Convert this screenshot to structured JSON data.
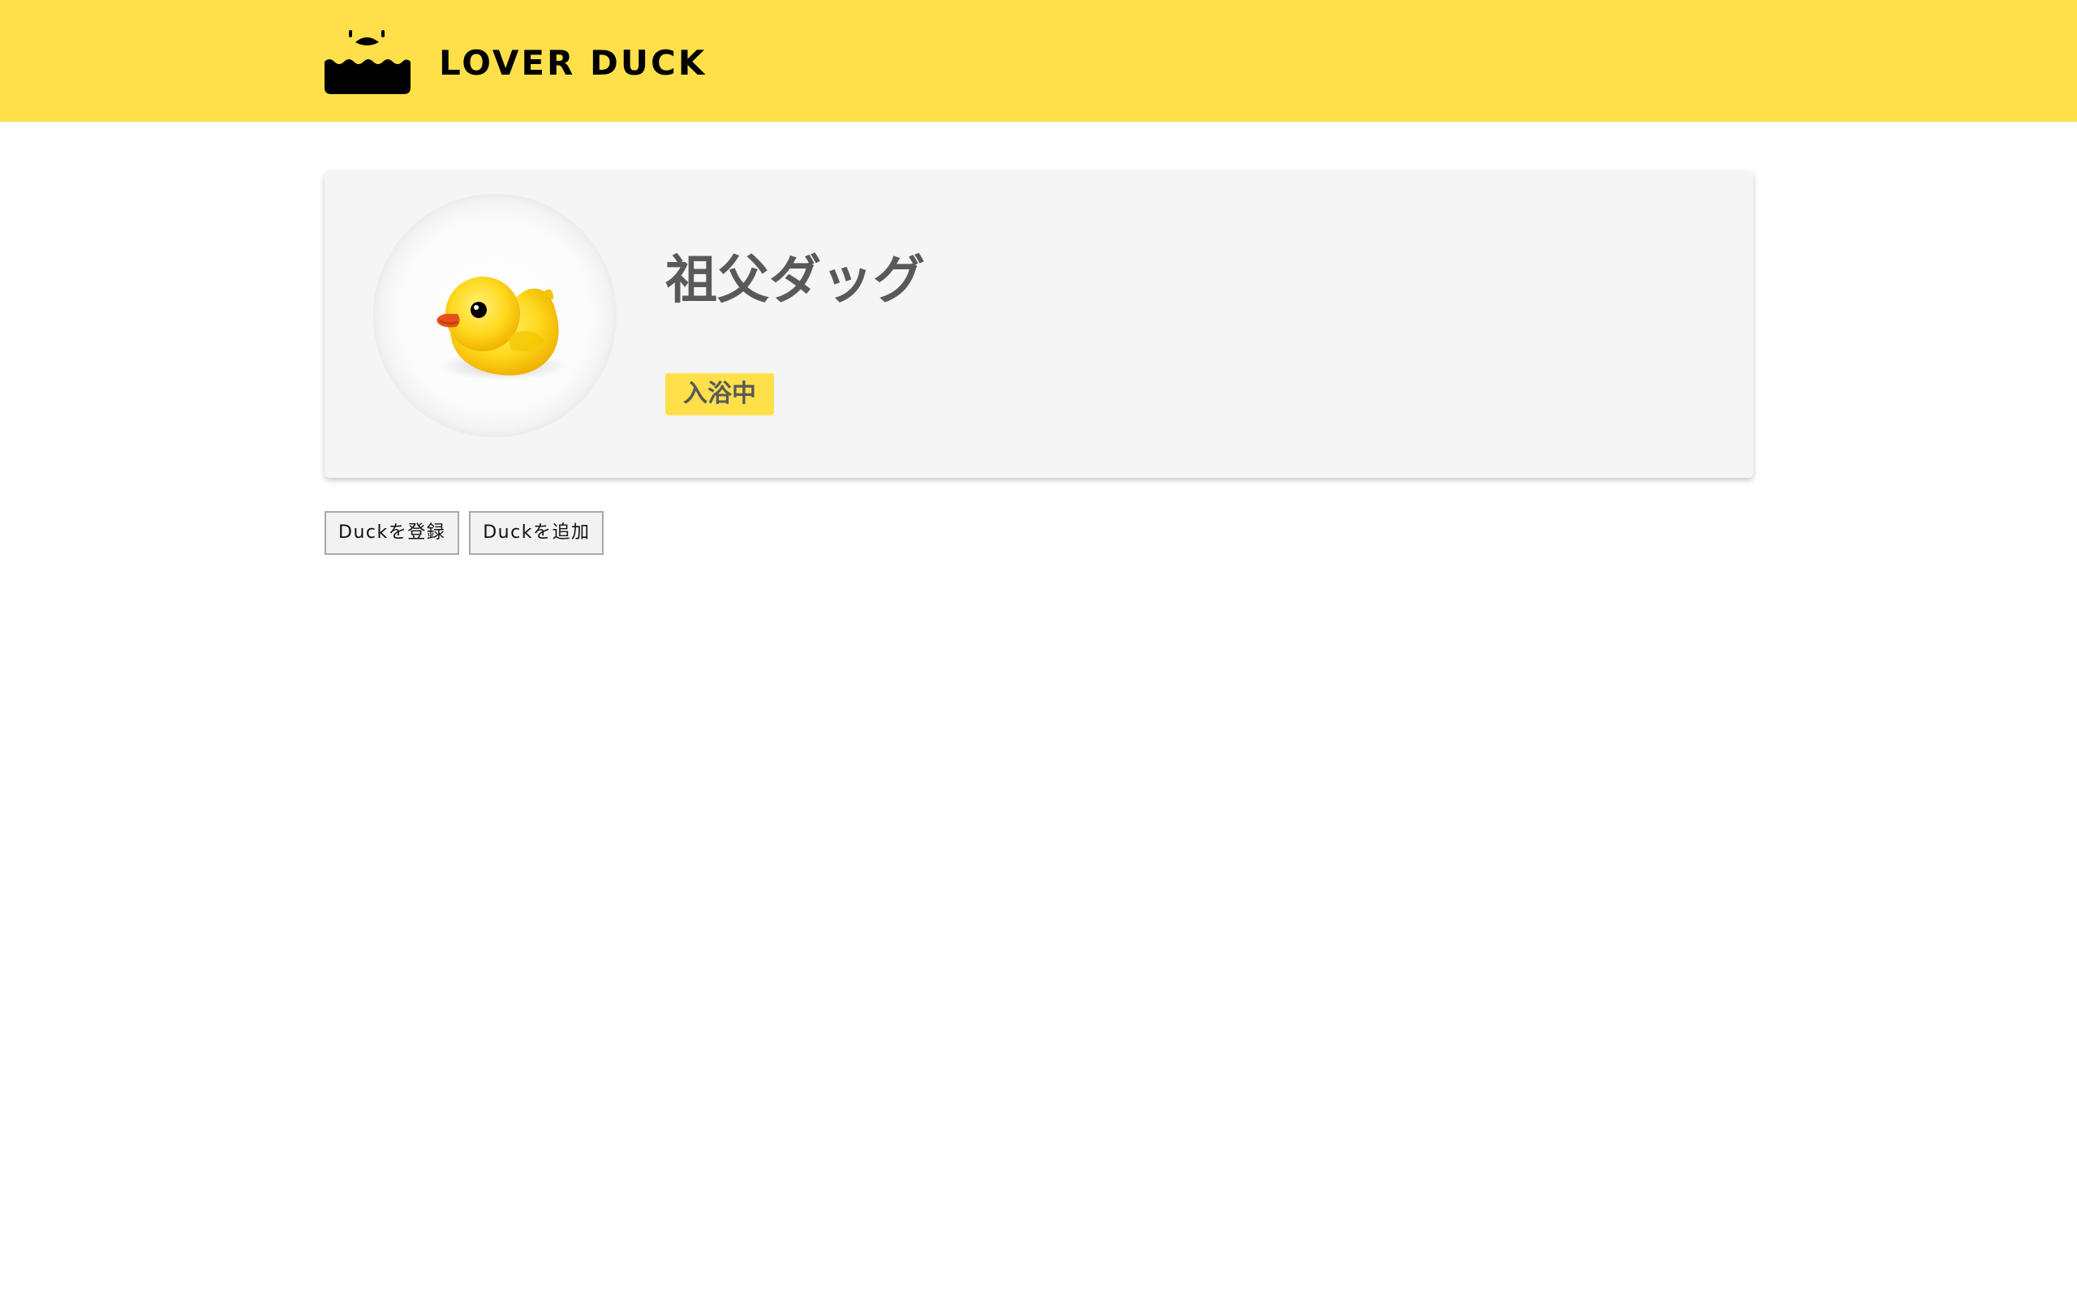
{
  "header": {
    "brand": "LOVER DUCK",
    "background_color": "#ffe04b",
    "logo_icon": "duck-in-bath-icon"
  },
  "duck_card": {
    "name": "祖父ダッグ",
    "status": "入浴中",
    "avatar_icon": "rubber-duck-photo"
  },
  "actions": {
    "register_label": "Duckを登録",
    "add_label": "Duckを追加"
  },
  "colors": {
    "accent": "#ffe04b",
    "card_background": "#f5f5f5",
    "text": "#595959"
  }
}
